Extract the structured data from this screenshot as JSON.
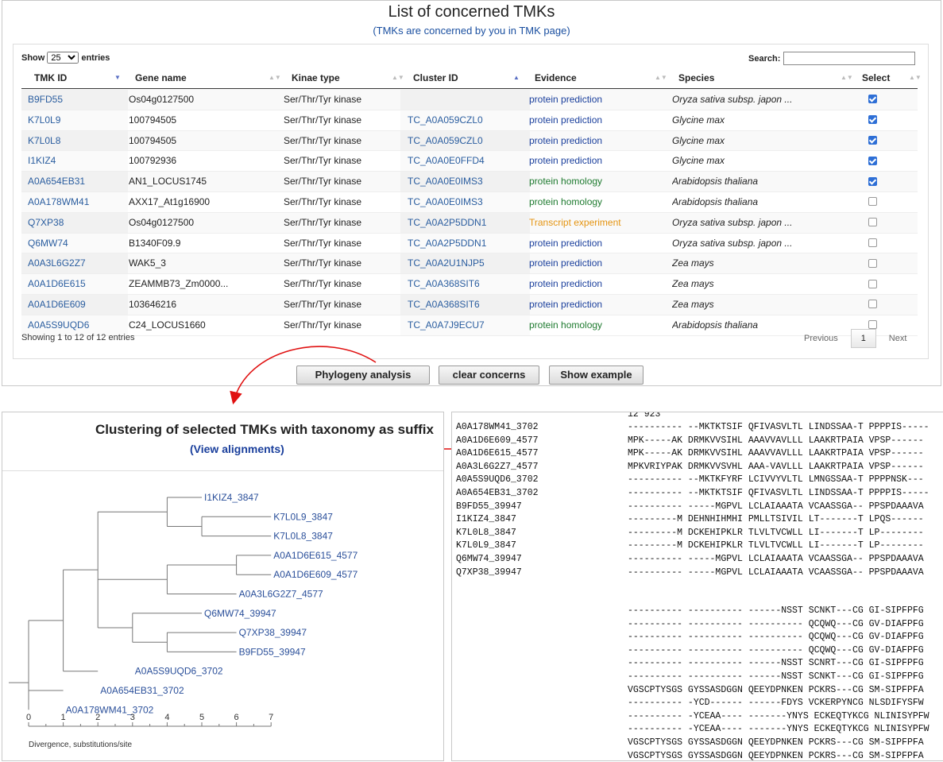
{
  "header": {
    "title": "List of concerned TMKs",
    "subtitle": "(TMKs are concerned by you in TMK page)"
  },
  "controls": {
    "show_label": "Show",
    "entries_value": "25",
    "entries_label": "entries",
    "search_label": "Search:",
    "search_value": ""
  },
  "columns": [
    "TMK ID",
    "Gene name",
    "Kinae type",
    "Cluster ID",
    "Evidence",
    "Species",
    "Select"
  ],
  "rows": [
    {
      "id": "B9FD55",
      "gene": "Os04g0127500",
      "kinase": "Ser/Thr/Tyr kinase",
      "cluster": "",
      "evidence": "protein prediction",
      "evtype": "prediction",
      "species": "Oryza sativa subsp. japon ...",
      "selected": true
    },
    {
      "id": "K7L0L9",
      "gene": "100794505",
      "kinase": "Ser/Thr/Tyr kinase",
      "cluster": "TC_A0A059CZL0",
      "evidence": "protein prediction",
      "evtype": "prediction",
      "species": "Glycine max",
      "selected": true
    },
    {
      "id": "K7L0L8",
      "gene": "100794505",
      "kinase": "Ser/Thr/Tyr kinase",
      "cluster": "TC_A0A059CZL0",
      "evidence": "protein prediction",
      "evtype": "prediction",
      "species": "Glycine max",
      "selected": true
    },
    {
      "id": "I1KIZ4",
      "gene": "100792936",
      "kinase": "Ser/Thr/Tyr kinase",
      "cluster": "TC_A0A0E0FFD4",
      "evidence": "protein prediction",
      "evtype": "prediction",
      "species": "Glycine max",
      "selected": true
    },
    {
      "id": "A0A654EB31",
      "gene": "AN1_LOCUS1745",
      "kinase": "Ser/Thr/Tyr kinase",
      "cluster": "TC_A0A0E0IMS3",
      "evidence": "protein homology",
      "evtype": "homology",
      "species": "Arabidopsis thaliana",
      "selected": true
    },
    {
      "id": "A0A178WM41",
      "gene": "AXX17_At1g16900",
      "kinase": "Ser/Thr/Tyr kinase",
      "cluster": "TC_A0A0E0IMS3",
      "evidence": "protein homology",
      "evtype": "homology",
      "species": "Arabidopsis thaliana",
      "selected": false
    },
    {
      "id": "Q7XP38",
      "gene": "Os04g0127500",
      "kinase": "Ser/Thr/Tyr kinase",
      "cluster": "TC_A0A2P5DDN1",
      "evidence": "Transcript experiment",
      "evtype": "transcript",
      "species": "Oryza sativa subsp. japon ...",
      "selected": false
    },
    {
      "id": "Q6MW74",
      "gene": "B1340F09.9",
      "kinase": "Ser/Thr/Tyr kinase",
      "cluster": "TC_A0A2P5DDN1",
      "evidence": "protein prediction",
      "evtype": "prediction",
      "species": "Oryza sativa subsp. japon ...",
      "selected": false
    },
    {
      "id": "A0A3L6G2Z7",
      "gene": "WAK5_3",
      "kinase": "Ser/Thr/Tyr kinase",
      "cluster": "TC_A0A2U1NJP5",
      "evidence": "protein prediction",
      "evtype": "prediction",
      "species": "Zea mays",
      "selected": false
    },
    {
      "id": "A0A1D6E615",
      "gene": "ZEAMMB73_Zm0000...",
      "kinase": "Ser/Thr/Tyr kinase",
      "cluster": "TC_A0A368SIT6",
      "evidence": "protein prediction",
      "evtype": "prediction",
      "species": "Zea mays",
      "selected": false
    },
    {
      "id": "A0A1D6E609",
      "gene": "103646216",
      "kinase": "Ser/Thr/Tyr kinase",
      "cluster": "TC_A0A368SIT6",
      "evidence": "protein prediction",
      "evtype": "prediction",
      "species": "Zea mays",
      "selected": false
    },
    {
      "id": "A0A5S9UQD6",
      "gene": "C24_LOCUS1660",
      "kinase": "Ser/Thr/Tyr kinase",
      "cluster": "TC_A0A7J9ECU7",
      "evidence": "protein homology",
      "evtype": "homology",
      "species": "Arabidopsis thaliana",
      "selected": false
    }
  ],
  "footer": {
    "info": "Showing 1 to 12 of 12 entries",
    "previous": "Previous",
    "page": "1",
    "next": "Next"
  },
  "buttons": {
    "phylogeny": "Phylogeny analysis",
    "clear": "clear concerns",
    "example": "Show example"
  },
  "tree": {
    "title": "Clustering of selected TMKs with taxonomy as suffix",
    "link": "(View alignments)",
    "leaves": [
      "I1KIZ4_3847",
      "K7L0L9_3847",
      "K7L0L8_3847",
      "A0A1D6E615_4577",
      "A0A1D6E609_4577",
      "A0A3L6G2Z7_4577",
      "Q6MW74_39947",
      "Q7XP38_39947",
      "B9FD55_39947",
      "A0A5S9UQD6_3702",
      "A0A654EB31_3702",
      "A0A178WM41_3702"
    ],
    "scale_ticks": [
      "0",
      "1",
      "2",
      "3",
      "4",
      "5",
      "6",
      "7"
    ],
    "scale_label": "Divergence, substitutions/site"
  },
  "alignment": {
    "top_fragment": "12 923",
    "block1": [
      {
        "name": "A0A178WM41_3702",
        "seq": "---------- --MKTKTSIF QFIVASVLTL LINDSSAA-T PPPPIS-----"
      },
      {
        "name": "A0A1D6E609_4577",
        "seq": "MPK-----AK DRMKVVSIHL AAAVVAVLLL LAAKRTPAIA VPSP------"
      },
      {
        "name": "A0A1D6E615_4577",
        "seq": "MPK-----AK DRMKVVSIHL AAAVVAVLLL LAAKRTPAIA VPSP------"
      },
      {
        "name": "A0A3L6G2Z7_4577",
        "seq": "MPKVRIYPAK DRMKVVSVHL AAA-VAVLLL LAAKRTPAIA VPSP------"
      },
      {
        "name": "A0A5S9UQD6_3702",
        "seq": "---------- --MKTKFYRF LCIVVYVLTL LMNGSSAA-T PPPPNSK---"
      },
      {
        "name": "A0A654EB31_3702",
        "seq": "---------- --MKTKTSIF QFIVASVLTL LINDSSAA-T PPPPIS-----"
      },
      {
        "name": "B9FD55_39947",
        "seq": "---------- -----MGPVL LCLAIAAATA VCAASSGA-- PPSPDAAAVA"
      },
      {
        "name": "I1KIZ4_3847",
        "seq": "---------M DEHNHIHMHI PMLLTSIVIL LT-------T LPQS------"
      },
      {
        "name": "K7L0L8_3847",
        "seq": "---------M DCKEHIPKLR TLVLTVCWLL LI-------T LP--------"
      },
      {
        "name": "K7L0L9_3847",
        "seq": "---------M DCKEHIPKLR TLVLTVCWLL LI-------T LP--------"
      },
      {
        "name": "Q6MW74_39947",
        "seq": "---------- -----MGPVL LCLAIAAATA VCAASSGA-- PPSPDAAAVA"
      },
      {
        "name": "Q7XP38_39947",
        "seq": "---------- -----MGPVL LCLAIAAATA VCAASSGA-- PPSPDAAAVA"
      }
    ],
    "block2": [
      "---------- ---------- ------NSST SCNKT---CG GI-SIPFPFG",
      "---------- ---------- ---------- QCQWQ---CG GV-DIAFPFG",
      "---------- ---------- ---------- QCQWQ---CG GV-DIAFPFG",
      "---------- ---------- ---------- QCQWQ---CG GV-DIAFPFG",
      "---------- ---------- ------NSST SCNRT---CG GI-SIPFPFG",
      "---------- ---------- ------NSST SCNKT---CG GI-SIPFPFG",
      "VGSCPTYSGS GYSSASDGGN QEEYDPNKEN PCKRS---CG SM-SIPFPFA",
      "---------- -YCD------ ------FDYS VCKERPYNCG NLSDIFYSFW",
      "---------- -YCEAA---- -------YNYS ECKEQTYKCG NLINISYPFW",
      "---------- -YCEAA---- -------YNYS ECKEQTYKCG NLINISYPFW",
      "VGSCPTYSGS GYSSASDGGN QEEYDPNKEN PCKRS---CG SM-SIPFPFA",
      "VGSCPTYSGS GYSSASDGGN QEEYDPNKEN PCKRS---CG SM-SIPFPFA"
    ]
  },
  "colors": {
    "link": "#2a5d9f",
    "prediction": "#1a3f9c",
    "homology": "#1e7a2f",
    "transcript": "#e59512",
    "arrow": "#e01010",
    "checkbox": "#2e6fd6"
  }
}
